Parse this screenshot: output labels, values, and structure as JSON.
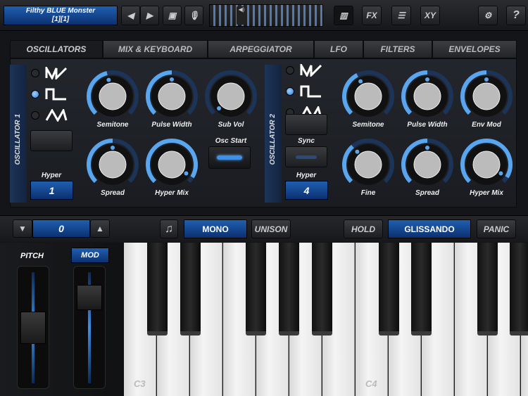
{
  "header": {
    "preset_name": "Filthy BLUE Monster",
    "preset_sub": "[1][1]",
    "fx_label": "FX",
    "xy_label": "XY",
    "help_label": "?"
  },
  "tabs": [
    {
      "label": "OSCILLATORS",
      "active": true
    },
    {
      "label": "MIX & KEYBOARD"
    },
    {
      "label": "ARPEGGIATOR"
    },
    {
      "label": "LFO"
    },
    {
      "label": "FILTERS"
    },
    {
      "label": "ENVELOPES"
    }
  ],
  "osc1": {
    "title": "OSCILLATOR 1",
    "selected_wave": "square",
    "hyper_label": "Hyper",
    "hyper_value": "1",
    "osc_start_label": "Osc Start",
    "knobs": [
      {
        "label": "Semitone",
        "value": 0.45
      },
      {
        "label": "Pulse Width",
        "value": 0.5
      },
      {
        "label": "Sub Vol",
        "value": 0.0
      },
      {
        "label": "Spread",
        "value": 0.5
      },
      {
        "label": "Hyper Mix",
        "value": 0.95
      }
    ]
  },
  "osc2": {
    "title": "OSCILLATOR 2",
    "selected_wave": "square",
    "sync_label": "Sync",
    "hyper_label": "Hyper",
    "hyper_value": "4",
    "knobs": [
      {
        "label": "Semitone",
        "value": 0.4
      },
      {
        "label": "Pulse Width",
        "value": 0.5
      },
      {
        "label": "Env Mod",
        "value": 0.5
      },
      {
        "label": "Fine",
        "value": 0.35
      },
      {
        "label": "Spread",
        "value": 0.5
      },
      {
        "label": "Hyper Mix",
        "value": 0.95
      }
    ]
  },
  "controls": {
    "octave_value": "0",
    "mono_label": "MONO",
    "unison_label": "UNISON",
    "hold_label": "HOLD",
    "glissando_label": "GLISSANDO",
    "panic_label": "PANIC"
  },
  "wheels": {
    "pitch_label": "PITCH",
    "mod_label": "MOD",
    "pitch_value": 0.5,
    "mod_value": 0.85
  },
  "keyboard": {
    "labels": [
      "C3",
      "C4"
    ]
  },
  "colors": {
    "accent": "#3d8fe8",
    "lcd": "#1a55a8"
  }
}
